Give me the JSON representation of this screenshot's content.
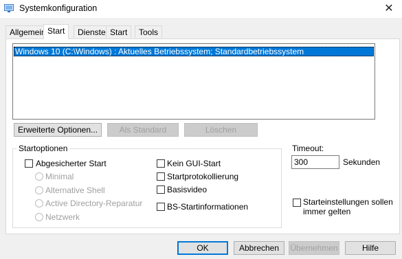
{
  "window": {
    "title": "Systemkonfiguration",
    "close_glyph": "✕"
  },
  "tabs": [
    {
      "label": "Allgemein",
      "active": false
    },
    {
      "label": "Start",
      "active": true
    },
    {
      "label": "Dienste",
      "active": false
    },
    {
      "label": "Start",
      "active": false
    },
    {
      "label": "Tools",
      "active": false
    }
  ],
  "boot_list": {
    "entries": [
      "Windows 10 (C:\\Windows) : Aktuelles Betriebssystem; Standardbetriebssystem"
    ],
    "selected_index": 0
  },
  "list_buttons": {
    "advanced": "Erweiterte Optionen...",
    "set_default": "Als Standard",
    "delete": "Löschen"
  },
  "boot_options": {
    "legend": "Startoptionen",
    "safe_boot": "Abgesicherter Start",
    "safe_boot_checked": false,
    "radios": [
      "Minimal",
      "Alternative Shell",
      "Active Directory-Reparatur",
      "Netzwerk"
    ],
    "no_gui": "Kein GUI-Start",
    "boot_log": "Startprotokollierung",
    "base_video": "Basisvideo",
    "os_boot_info": "BS-Startinformationen"
  },
  "timeout": {
    "label": "Timeout:",
    "value": "300",
    "unit": "Sekunden"
  },
  "permanent": {
    "line1": "Starteinstellungen sollen",
    "line2": "immer gelten",
    "checked": false
  },
  "dialog_buttons": {
    "ok": "OK",
    "cancel": "Abbrechen",
    "apply": "Übernehmen",
    "help": "Hilfe"
  },
  "colors": {
    "selection": "#0078d7",
    "accent_border": "#0078d7",
    "disabled_text": "#a0a0a0"
  },
  "icons": {
    "app": "system-config-icon",
    "close": "close-icon"
  }
}
